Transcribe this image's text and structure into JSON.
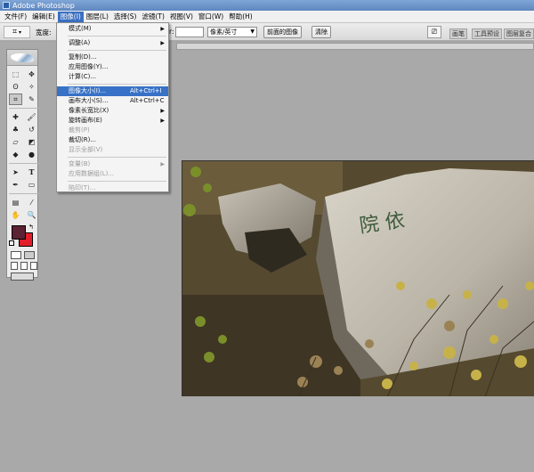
{
  "titlebar": {
    "title": "Adobe Photoshop"
  },
  "menubar": {
    "items": [
      {
        "label": "文件(F)"
      },
      {
        "label": "编辑(E)"
      },
      {
        "label": "图像(I)"
      },
      {
        "label": "图层(L)"
      },
      {
        "label": "选择(S)"
      },
      {
        "label": "滤镜(T)"
      },
      {
        "label": "视图(V)"
      },
      {
        "label": "窗口(W)"
      },
      {
        "label": "帮助(H)"
      }
    ]
  },
  "options": {
    "width_label": "宽度:",
    "resolution_label": "r:",
    "unit_select": "像素/英寸",
    "front_image_button": "前面的图像",
    "clear_button": "清除"
  },
  "panel_tabs": [
    "画笔",
    "工具预设",
    "图层复合"
  ],
  "image_menu": {
    "items": [
      {
        "label": "模式(M)",
        "submenu": true
      },
      {
        "sep": true
      },
      {
        "label": "调整(A)",
        "submenu": true
      },
      {
        "sep": true
      },
      {
        "label": "复制(D)..."
      },
      {
        "label": "应用图像(Y)..."
      },
      {
        "label": "计算(C)..."
      },
      {
        "sep": true
      },
      {
        "label": "图像大小(I)...",
        "shortcut": "Alt+Ctrl+I",
        "highlighted": true
      },
      {
        "label": "画布大小(S)...",
        "shortcut": "Alt+Ctrl+C"
      },
      {
        "label": "像素长宽比(X)",
        "submenu": true
      },
      {
        "label": "旋转画布(E)",
        "submenu": true
      },
      {
        "label": "裁剪(P)",
        "disabled": true
      },
      {
        "label": "裁切(R)..."
      },
      {
        "label": "显示全部(V)",
        "disabled": true
      },
      {
        "sep": true
      },
      {
        "label": "变量(B)",
        "submenu": true,
        "disabled": true
      },
      {
        "label": "应用数据组(L)...",
        "disabled": true
      },
      {
        "sep": true
      },
      {
        "label": "陷印(T)...",
        "disabled": true
      }
    ]
  },
  "photo": {
    "engraving": "院 依"
  },
  "colors": {
    "foreground": "#5b2233",
    "background": "#e21e2a",
    "menu_highlight": "#3872c6"
  }
}
